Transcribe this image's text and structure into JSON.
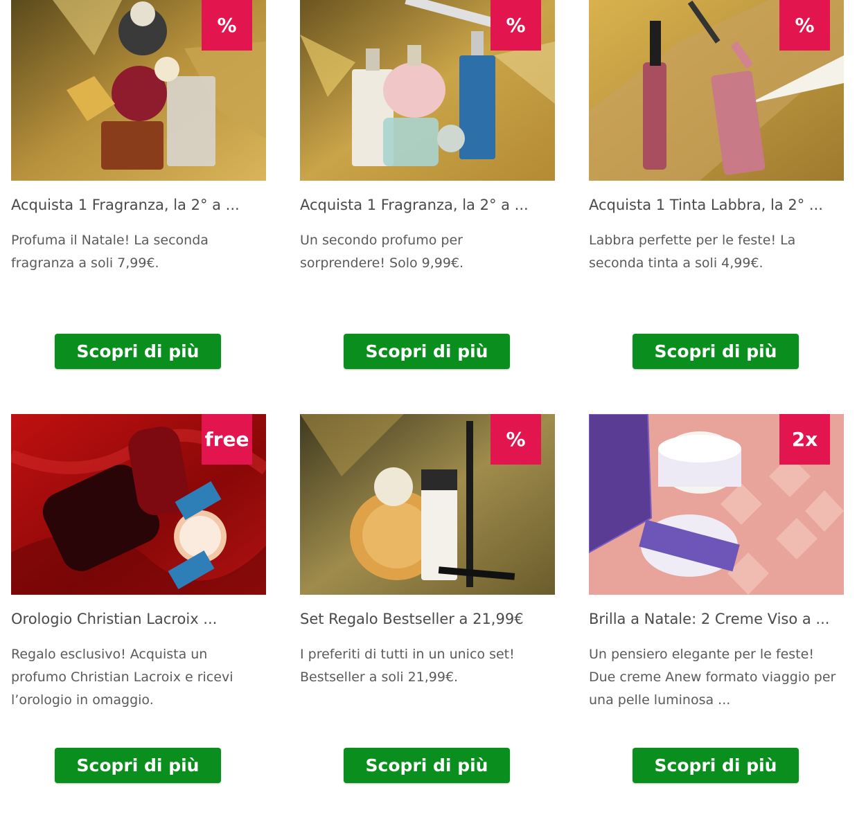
{
  "cards": [
    {
      "title": "Acquista 1 Fragranza, la 2° a ...",
      "desc": "Profuma il Natale! La seconda fragranza a soli 7,99€.",
      "badge": "%",
      "button": "Scopri di più",
      "image_desc": "perfume-bottles-gold-background"
    },
    {
      "title": "Acquista 1 Fragranza, la 2° a ...",
      "desc": "Un secondo profumo per sorprendere! Solo 9,99€.",
      "badge": "%",
      "button": "Scopri di più",
      "image_desc": "perfume-bottles-gold-background"
    },
    {
      "title": "Acquista 1 Tinta Labbra, la 2° ...",
      "desc": "Labbra perfette per le feste! La seconda tinta a soli 4,99€.",
      "badge": "%",
      "button": "Scopri di più",
      "image_desc": "lip-gloss-gold-glitter"
    },
    {
      "title": "Orologio Christian Lacroix ...",
      "desc": "Regalo esclusivo! Acquista un profumo Christian Lacroix e ricevi l’orologio in omaggio.",
      "badge": "free",
      "button": "Scopri di più",
      "image_desc": "perfume-and-watch-red-silk"
    },
    {
      "title": "Set Regalo Bestseller a 21,99€",
      "desc": "I preferiti di tutti in un unico set! Bestseller a soli 21,99€.",
      "badge": "%",
      "button": "Scopri di più",
      "image_desc": "bestseller-set-gold"
    },
    {
      "title": "Brilla a Natale: 2 Creme Viso a ...",
      "desc": "Un pensiero elegante per le feste! Due creme Anew formato viaggio per una pelle luminosa ...",
      "badge": "2x",
      "button": "Scopri di più",
      "image_desc": "anew-face-creams-pink"
    }
  ],
  "colors": {
    "badge": "#e3154f",
    "button": "#0a8f1e",
    "text": "#4a4a4a"
  }
}
